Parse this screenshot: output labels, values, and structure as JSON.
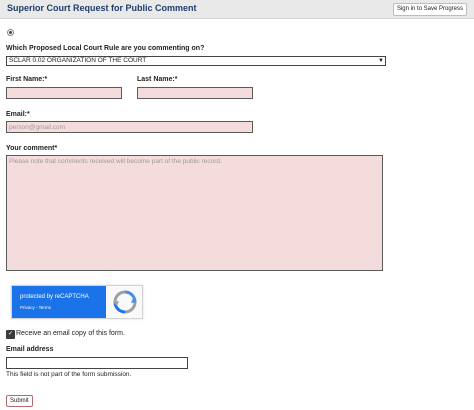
{
  "header": {
    "title": "Superior Court Request for Public Comment",
    "sign_in_label": "Sign in to Save Progress"
  },
  "form": {
    "rule_question": "Which Proposed Local Court Rule are you commenting on?",
    "rule_selected": "SCLAR 0.02 ORGANIZATION OF THE COURT",
    "first_name_label": "First Name:*",
    "last_name_label": "Last Name:*",
    "email_label": "Email:*",
    "email_placeholder": "person@gmail.com",
    "comment_label": "Your comment*",
    "comment_placeholder": "Please note that comments received will become part of the public record.",
    "recaptcha": {
      "text": "protected by reCAPTCHA",
      "links": "Privacy - Terms"
    },
    "email_copy_label": "Receive an email copy of this form.",
    "email_copy_checked": true,
    "email_address_label": "Email address",
    "email_address_note": "This field is not part of the form submission.",
    "submit_label": "Submit"
  }
}
